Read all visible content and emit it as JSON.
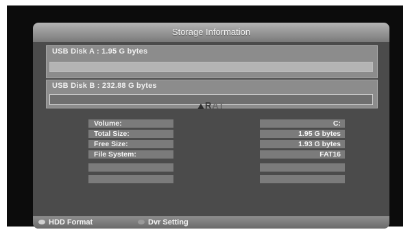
{
  "window": {
    "title": "Storage Information"
  },
  "disks": [
    {
      "label": "USB Disk A : 1.95 G bytes"
    },
    {
      "label": "USB Disk B : 232.88 G bytes"
    }
  ],
  "watermark": {
    "text_a": "A",
    "text_b": "R",
    "text_c": "AT"
  },
  "info": {
    "rows": [
      {
        "label": "Volume:",
        "value": "C:"
      },
      {
        "label": "Total Size:",
        "value": "1.95 G bytes"
      },
      {
        "label": "Free Size:",
        "value": "1.93 G bytes"
      },
      {
        "label": "File System:",
        "value": "FAT16"
      },
      {
        "label": "",
        "value": ""
      },
      {
        "label": "",
        "value": ""
      }
    ]
  },
  "footer": {
    "hdd_format_label": "HDD Format",
    "dvr_setting_label": "Dvr Setting"
  },
  "colors": {
    "panel": "#4b4b4b",
    "title_bar": "#9a9a9a",
    "cell": "#7b7b7b"
  }
}
